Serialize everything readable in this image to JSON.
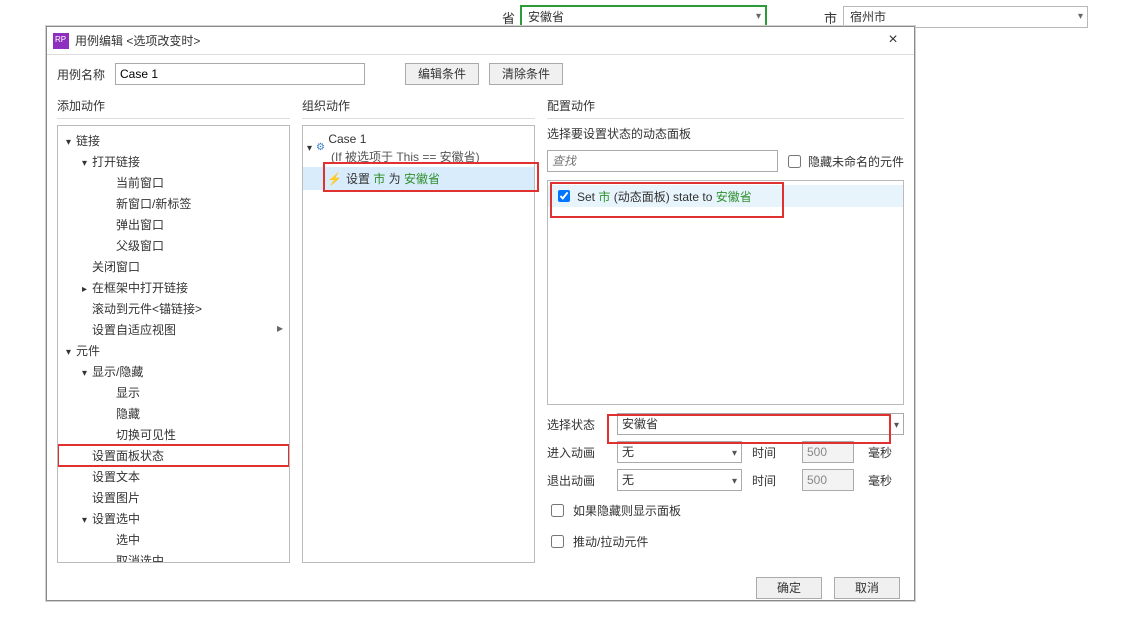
{
  "bg": {
    "province_label": "省",
    "province_value": "安徽省",
    "city_label": "市",
    "city_value": "宿州市"
  },
  "dialog": {
    "title": "用例编辑 <选项改变时>",
    "close": "×",
    "case_name_label": "用例名称",
    "case_name_value": "Case 1",
    "btn_edit_cond": "编辑条件",
    "btn_clear_cond": "清除条件"
  },
  "panels": {
    "left_head": "添加动作",
    "mid_head": "组织动作",
    "right_head": "配置动作"
  },
  "left_tree": [
    {
      "d": 0,
      "tri": "e",
      "t": "链接"
    },
    {
      "d": 1,
      "tri": "e",
      "t": "打开链接"
    },
    {
      "d": 2,
      "tri": "",
      "t": "当前窗口"
    },
    {
      "d": 2,
      "tri": "",
      "t": "新窗口/新标签"
    },
    {
      "d": 2,
      "tri": "",
      "t": "弹出窗口"
    },
    {
      "d": 2,
      "tri": "",
      "t": "父级窗口"
    },
    {
      "d": 1,
      "tri": "",
      "t": "关闭窗口"
    },
    {
      "d": 1,
      "tri": "c",
      "t": "在框架中打开链接"
    },
    {
      "d": 1,
      "tri": "",
      "t": "滚动到元件<锚链接>"
    },
    {
      "d": 1,
      "tri": "",
      "t": "设置自适应视图",
      "arrow": true
    },
    {
      "d": 0,
      "tri": "e",
      "t": "元件"
    },
    {
      "d": 1,
      "tri": "e",
      "t": "显示/隐藏"
    },
    {
      "d": 2,
      "tri": "",
      "t": "显示"
    },
    {
      "d": 2,
      "tri": "",
      "t": "隐藏"
    },
    {
      "d": 2,
      "tri": "",
      "t": "切换可见性"
    },
    {
      "d": 1,
      "tri": "",
      "t": "设置面板状态",
      "hl": true
    },
    {
      "d": 1,
      "tri": "",
      "t": "设置文本"
    },
    {
      "d": 1,
      "tri": "",
      "t": "设置图片"
    },
    {
      "d": 1,
      "tri": "e",
      "t": "设置选中"
    },
    {
      "d": 2,
      "tri": "",
      "t": "选中"
    },
    {
      "d": 2,
      "tri": "",
      "t": "取消选中"
    }
  ],
  "mid": {
    "case_label": "Case 1",
    "cond": "(If 被选项于 This == 安徽省)",
    "action_prefix": "设置 ",
    "action_g1": "市",
    "action_mid": " 为 ",
    "action_g2": "安徽省"
  },
  "right": {
    "head": "选择要设置状态的动态面板",
    "search_ph": "查找",
    "hide_unnamed": "隐藏未命名的元件",
    "item_prefix": "Set ",
    "item_g1": "市",
    "item_mid1": " (动态面板) state to ",
    "item_g2": "安徽省",
    "sel_state_lbl": "选择状态",
    "sel_state_val": "安徽省",
    "anim_in_lbl": "进入动画",
    "anim_out_lbl": "退出动画",
    "anim_none": "无",
    "time_lbl": "时间",
    "time_val": "500",
    "ms": "毫秒",
    "cb_show_if_hidden": "如果隐藏则显示面板",
    "cb_push_pull": "推动/拉动元件"
  },
  "footer": {
    "ok": "确定",
    "cancel": "取消"
  }
}
